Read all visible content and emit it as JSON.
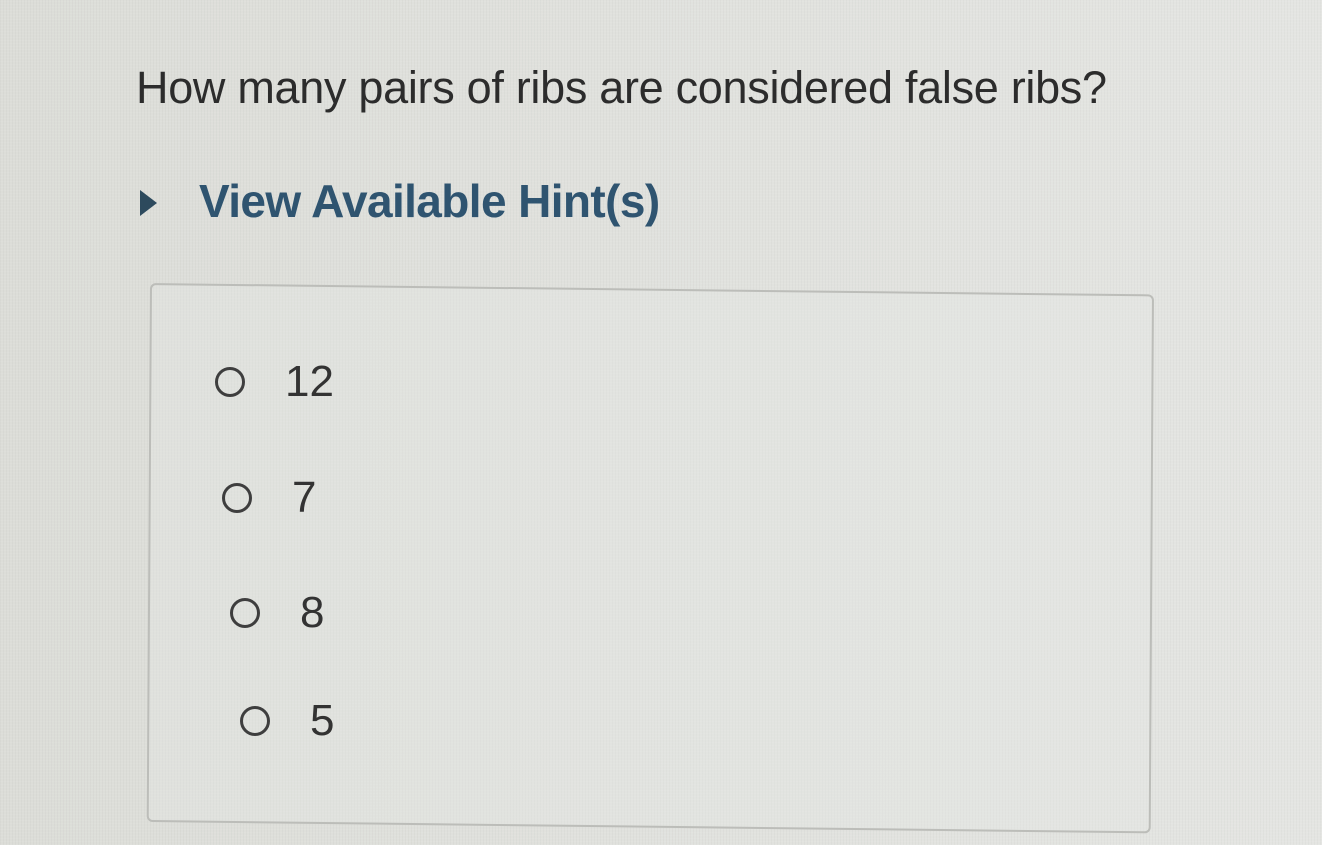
{
  "question": {
    "text": "How many pairs of ribs are considered false ribs?"
  },
  "hint": {
    "label": "View Available Hint(s)",
    "icon": "triangle-right-icon",
    "color": "#2f5470"
  },
  "options": [
    {
      "label": "12",
      "selected": false
    },
    {
      "label": "7",
      "selected": false
    },
    {
      "label": "8",
      "selected": false
    },
    {
      "label": "5",
      "selected": false
    }
  ]
}
